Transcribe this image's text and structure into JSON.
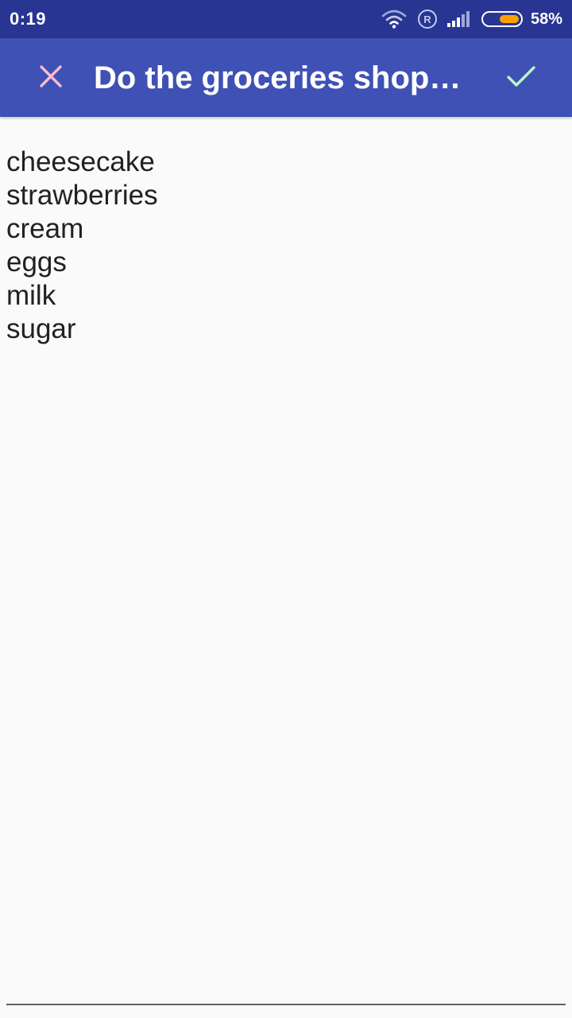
{
  "status_bar": {
    "time": "0:19",
    "roaming": "R",
    "battery_percent": "58%",
    "battery_level": 0.58,
    "icons": [
      "wifi-icon",
      "roaming-icon",
      "signal-icon",
      "battery-icon"
    ],
    "background": "#283593",
    "battery_color": "#ffa000"
  },
  "toolbar": {
    "title": "Do the groceries shop…",
    "close_icon": "close-icon",
    "done_icon": "check-icon",
    "background": "#3f51b5",
    "close_color": "#f8bbd0",
    "done_color": "#b9f6ca"
  },
  "note": {
    "lines": [
      "cheesecake",
      "strawberries",
      "cream",
      "eggs",
      "milk",
      "sugar"
    ]
  }
}
